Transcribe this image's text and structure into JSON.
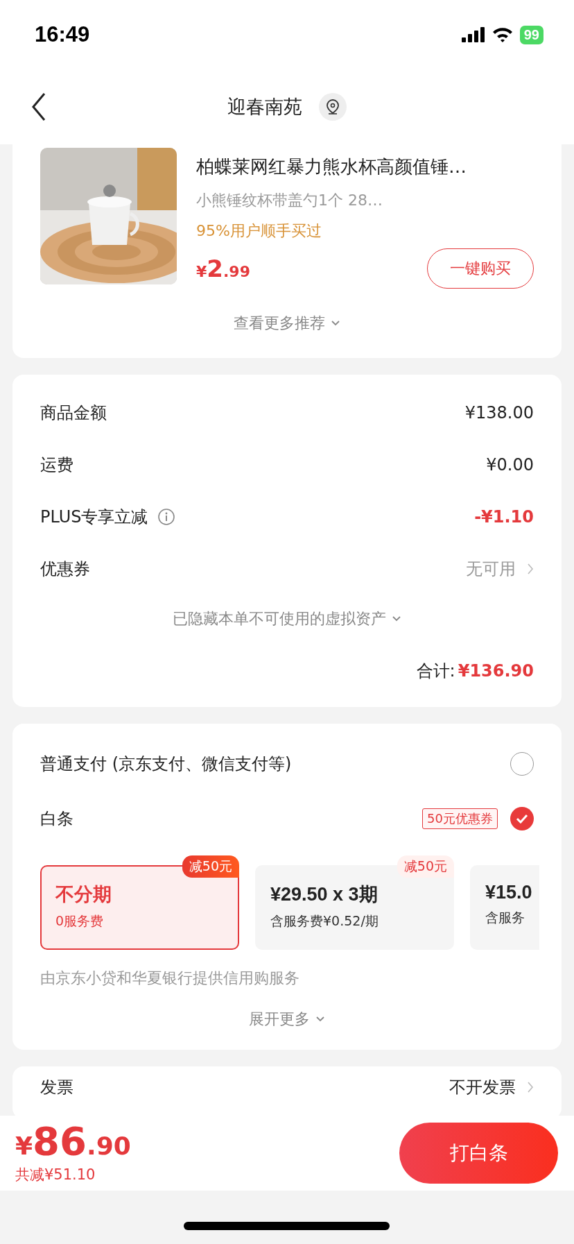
{
  "status_bar": {
    "time": "16:49",
    "battery": "99"
  },
  "nav": {
    "title": "迎春南苑"
  },
  "recommendation": {
    "title": "柏蝶莱网红暴力熊水杯高颜值锤…",
    "subtitle": "小熊锤纹杯带盖勺1个 28…",
    "note": "95%用户顺手买过",
    "price": {
      "currency": "¥",
      "integer": "2",
      "decimal": ".99"
    },
    "button": "一键购买",
    "more": "查看更多推荐"
  },
  "summary": {
    "rows": [
      {
        "label": "商品金额",
        "value": "¥138.00",
        "kind": "amount",
        "info": false
      },
      {
        "label": "运费",
        "value": "¥0.00",
        "kind": "amount",
        "info": false
      },
      {
        "label": "PLUS专享立减",
        "value": "-¥1.10",
        "kind": "discount",
        "info": true
      },
      {
        "label": "优惠券",
        "value": "无可用",
        "kind": "link",
        "info": false
      }
    ],
    "hidden_note": "已隐藏本单不可使用的虚拟资产",
    "total_label": "合计:",
    "total_value": "¥136.90"
  },
  "payment": {
    "options": [
      {
        "label": "普通支付 (京东支付、微信支付等)",
        "selected": false
      },
      {
        "label": "白条",
        "selected": true,
        "coupon": "50元优惠券"
      }
    ],
    "plans": [
      {
        "title": "不分期",
        "note": "0服务费",
        "badge": "减50元",
        "selected": true
      },
      {
        "title": "¥29.50 x 3期",
        "note": "含服务费¥0.52/期",
        "badge": "减50元",
        "selected": false
      },
      {
        "title": "¥15.0",
        "note": "含服务",
        "selected": false
      }
    ],
    "provider": "由京东小贷和华夏银行提供信用购服务",
    "expand": "展开更多"
  },
  "invoice": {
    "label": "发票",
    "value": "不开发票"
  },
  "bottom_bar": {
    "price": {
      "currency": "¥",
      "integer": "86",
      "decimal": ".90"
    },
    "saved": "共减¥51.10",
    "button": "打白条"
  }
}
